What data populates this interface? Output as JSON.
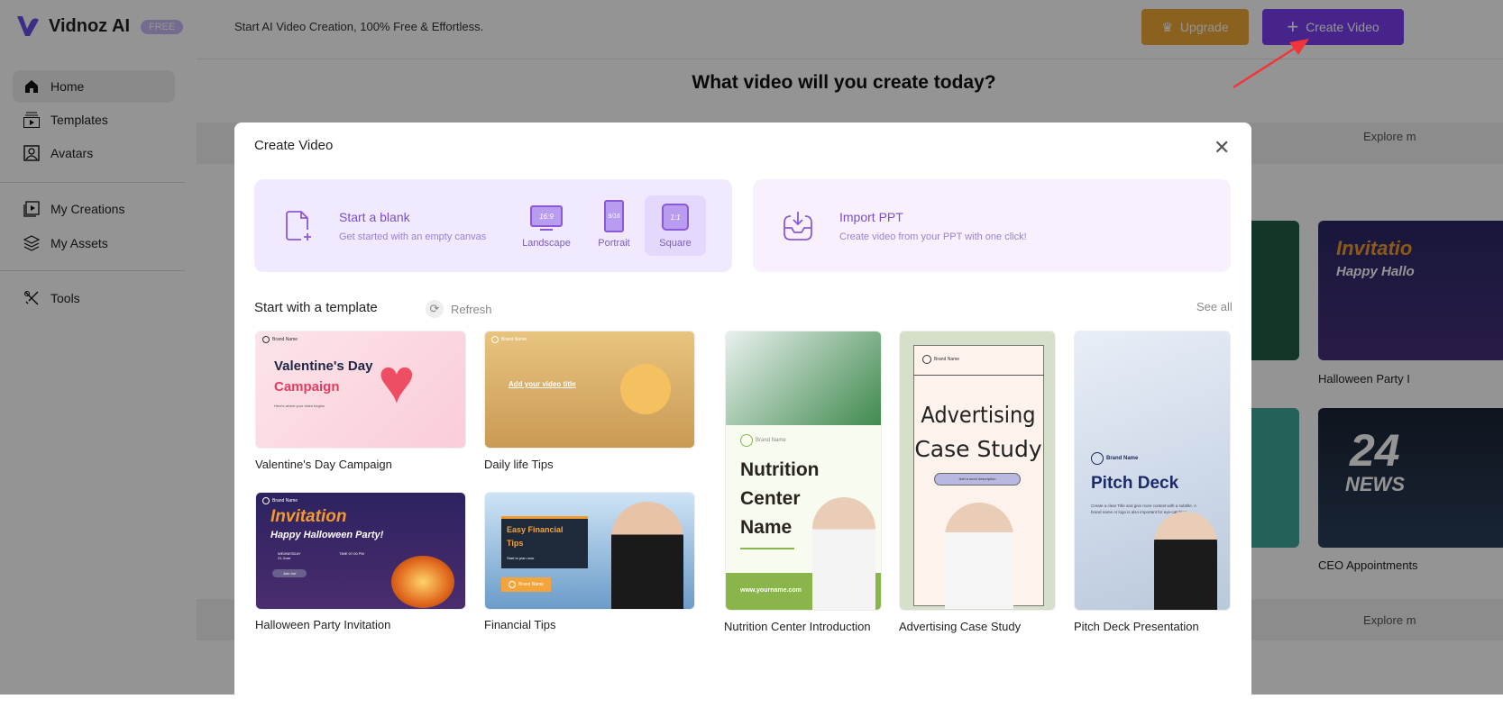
{
  "app": {
    "name": "Vidnoz AI",
    "badge": "FREE",
    "tagline": "Start AI Video Creation, 100% Free & Effortless."
  },
  "header": {
    "upgrade_label": "Upgrade",
    "create_label": "Create Video"
  },
  "sidebar": {
    "items": [
      {
        "label": "Home",
        "icon": "home-icon",
        "active": true
      },
      {
        "label": "Templates",
        "icon": "templates-icon"
      },
      {
        "label": "Avatars",
        "icon": "avatar-icon"
      },
      {
        "label": "My Creations",
        "icon": "play-library-icon"
      },
      {
        "label": "My Assets",
        "icon": "layers-icon"
      },
      {
        "label": "Tools",
        "icon": "tools-icon"
      }
    ]
  },
  "background": {
    "title": "What video will you create today?",
    "explore_label": "Explore m",
    "cards": [
      {
        "label": "Halloween Party I"
      },
      {
        "label": "CEO Appointments"
      }
    ]
  },
  "modal": {
    "title": "Create Video",
    "blank": {
      "title": "Start a blank",
      "subtitle": "Get started with an empty canvas",
      "ratios": [
        {
          "label": "Landscape",
          "glyph": "16:9"
        },
        {
          "label": "Portrait",
          "glyph": "9/16"
        },
        {
          "label": "Square",
          "glyph": "1:1",
          "selected": true
        }
      ]
    },
    "ppt": {
      "title": "Import PPT",
      "subtitle": "Create video from your PPT with one click!"
    },
    "templates_title": "Start with a template",
    "refresh_label": "Refresh",
    "see_all_label": "See all",
    "templates": [
      {
        "label": "Valentine's Day Campaign",
        "thumb": {
          "brand": "Brand Name",
          "line1": "Valentine's Day",
          "line2": "Campaign",
          "sub": "Here's where your video begins"
        }
      },
      {
        "label": "Daily life Tips",
        "thumb": {
          "brand": "Brand Name",
          "line1": "Add your video title"
        }
      },
      {
        "label": "Halloween Party Invitation",
        "thumb": {
          "brand": "Brand Name",
          "line1": "Invitation",
          "line2": "Happy Halloween Party!",
          "date": "WEDNESDAY 21 June",
          "time": "TIME 07:00 PM",
          "button": "Join Us!"
        }
      },
      {
        "label": "Financial Tips",
        "thumb": {
          "line1": "Easy Financial Tips",
          "sub": "Start to plan now.",
          "brand": "Brand Name"
        }
      },
      {
        "label": "Nutrition Center Introduction",
        "thumb": {
          "brand": "Brand Name",
          "line1": "Nutrition",
          "line2": "Center",
          "line3": "Name",
          "url": "www.yourname.com"
        }
      },
      {
        "label": "Advertising Case Study",
        "thumb": {
          "brand": "Brand Name",
          "line1": "Advertising",
          "line2": "Case Study",
          "button": "Add a short description"
        }
      },
      {
        "label": "Pitch Deck Presentation",
        "thumb": {
          "brand": "Brand Name",
          "line1": "Pitch Deck",
          "sub": "Create a clear Title and give more context with a subtitle. A brand name or logo is also important for eye-catching."
        }
      }
    ]
  },
  "colors": {
    "accent": "#7b3ff2",
    "upgrade": "#f0a838",
    "annotation_arrow": "#f0363a"
  }
}
